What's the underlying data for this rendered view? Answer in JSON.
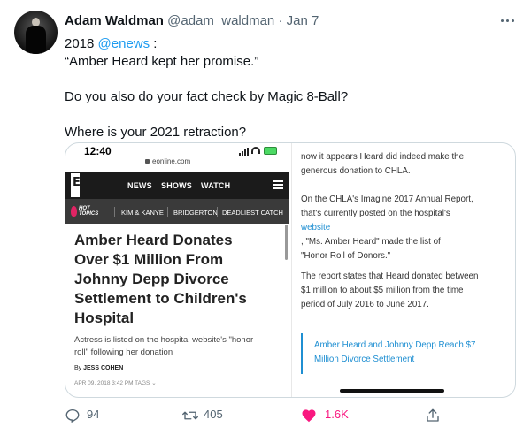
{
  "tweet": {
    "author_name": "Adam Waldman",
    "handle": "@adam_waldman",
    "separator": "·",
    "date": "Jan 7",
    "text_prefix": "2018 ",
    "mention": "@enews",
    "text_suffix": " :",
    "lines": [
      "“Amber Heard kept her promise.”",
      "Do you also do your fact check by Magic 8-Ball?",
      "Where is your 2021 retraction?"
    ]
  },
  "screenshot_left": {
    "time": "12:40",
    "url": "eonline.com",
    "logo_letter": "E",
    "nav": [
      "NEWS",
      "SHOWS",
      "WATCH"
    ],
    "hot_topics_label": [
      "HOT",
      "TOPICS"
    ],
    "hot_topics": [
      "KIM & KANYE",
      "BRIDGERTON",
      "DEADLIEST CATCH"
    ],
    "headline_lines": [
      "Amber Heard Donates",
      "Over $1 Million From",
      "Johnny Depp Divorce",
      "Settlement to Children's",
      "Hospital"
    ],
    "subtitle_lines": [
      "Actress is listed on the hospital website's \"honor",
      "roll\" following her donation"
    ],
    "byline_prefix": "By",
    "byline_author": "JESS COHEN",
    "meta": "APR 09, 2018 3:42 PM  TAGS"
  },
  "screenshot_right": {
    "p1_lines": [
      "now it appears Heard did indeed make the",
      "generous donation to CHLA."
    ],
    "p2_lines": [
      "On the CHLA's Imagine 2017 Annual Report,",
      "that's currently posted on the hospital's"
    ],
    "p2_link": "website",
    "p2_line3_rest": ", \"Ms. Amber Heard\" made the list of",
    "p2_line4": "\"Honor Roll of Donors.\"",
    "p3_lines": [
      "The report states that Heard donated between",
      "$1 million to about $5 million from the time",
      "period of July 2016 to June 2017."
    ],
    "callout_lines": [
      "Amber Heard and Johnny Depp Reach $7",
      "Million Divorce Settlement"
    ]
  },
  "actions": {
    "replies": "94",
    "retweets": "405",
    "likes": "1.6K"
  },
  "colors": {
    "accent": "#1d9bf0",
    "like": "#f91880",
    "muted": "#536471",
    "link_in_article": "#1f8fd2"
  },
  "icons": [
    "more-icon",
    "reply-icon",
    "retweet-icon",
    "like-icon",
    "share-icon",
    "hamburger-icon",
    "lock-icon",
    "flame-icon"
  ]
}
